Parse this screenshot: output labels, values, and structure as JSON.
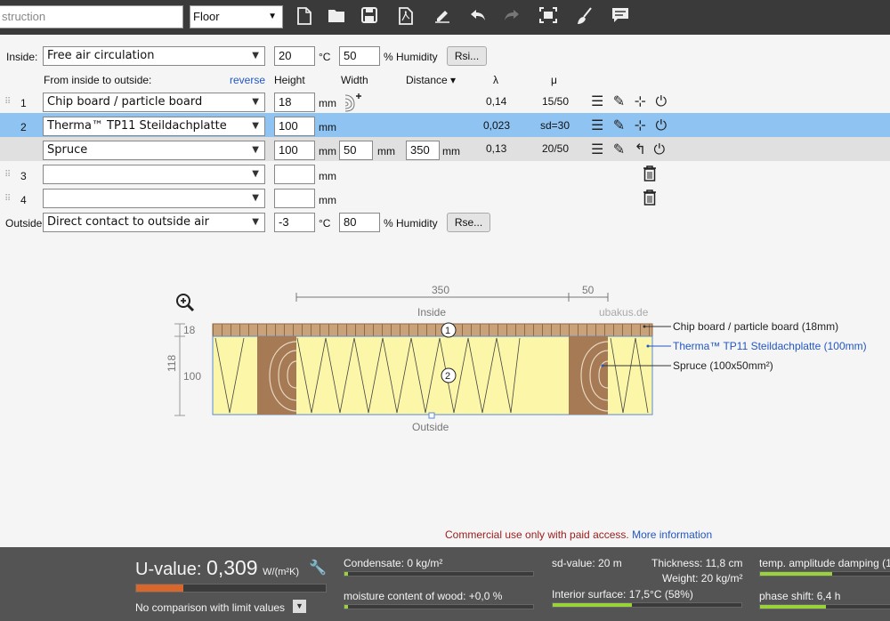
{
  "toolbar": {
    "search_placeholder": "struction",
    "construction_type": "Floor",
    "icons": [
      "new-file-icon",
      "open-folder-icon",
      "save-icon",
      "pdf-icon",
      "edit-sign-icon",
      "undo-icon",
      "redo-icon",
      "fullscreen-icon",
      "clean-icon",
      "comment-icon"
    ]
  },
  "inside": {
    "label": "Inside:",
    "condition": "Free air circulation",
    "temp": "20",
    "temp_unit": "°C",
    "humidity": "50",
    "humidity_label": "% Humidity",
    "button": "Rsi..."
  },
  "headers": {
    "from_inside": "From inside to outside:",
    "reverse": "reverse",
    "height": "Height",
    "width": "Width",
    "distance": "Distance ▾",
    "lambda": "λ",
    "mu": "μ"
  },
  "layers": [
    {
      "num": "1",
      "material": "Chip board / particle board",
      "height": "18",
      "unit": "mm",
      "lambda": "0,14",
      "mu": "15/50"
    },
    {
      "num": "2",
      "material": "Therma™ TP11 Steildachplatte",
      "height": "100",
      "unit": "mm",
      "lambda": "0,023",
      "mu": "sd=30"
    },
    {
      "num": "",
      "material": "Spruce",
      "height": "100",
      "unit": "mm",
      "width": "50",
      "width_unit": "mm",
      "distance": "350",
      "distance_unit": "mm",
      "lambda": "0,13",
      "mu": "20/50"
    },
    {
      "num": "3",
      "material": "",
      "height": "",
      "unit": "mm"
    },
    {
      "num": "4",
      "material": "",
      "height": "",
      "unit": "mm"
    }
  ],
  "outside": {
    "label": "Outside",
    "condition": "Direct contact to outside air",
    "temp": "-3",
    "temp_unit": "°C",
    "humidity": "80",
    "humidity_label": "% Humidity",
    "button": "Rse..."
  },
  "diagram": {
    "dim_350": "350",
    "dim_50": "50",
    "inside": "Inside",
    "watermark": "ubakus.de",
    "outside": "Outside",
    "total": "118",
    "h18": "18",
    "h100": "100",
    "marker1": "1",
    "marker2": "2",
    "legend": [
      "Chip board / particle board (18mm)",
      "Therma™ TP11 Steildachplatte (100mm)",
      "Spruce (100x50mm²)"
    ],
    "colors": {
      "board": "#c9a27a",
      "insulation": "#fbf6a8",
      "wood": "#a57a55",
      "accent": "#2257c4"
    }
  },
  "notice": {
    "text": "Commercial use only with paid access.",
    "link": "More information"
  },
  "status": {
    "uvalue_label": "U-value:",
    "uvalue": "0,309",
    "uvalue_unit": "W/(m²K)",
    "uvalue_fill": 0.25,
    "comparison": "No comparison with limit values",
    "condensate": "Condensate: 0 kg/m²",
    "moisture": "moisture content of wood: +0,0 %",
    "sd_value": "sd-value: 20 m",
    "thickness": "Thickness: 11,8 cm",
    "weight": "Weight: 20 kg/m²",
    "interior_surface": "Interior surface: 17,5°C (58%)",
    "temp_amplitude": "temp. amplitude damping (1",
    "phase_shift": "phase shift: 6,4 h"
  }
}
